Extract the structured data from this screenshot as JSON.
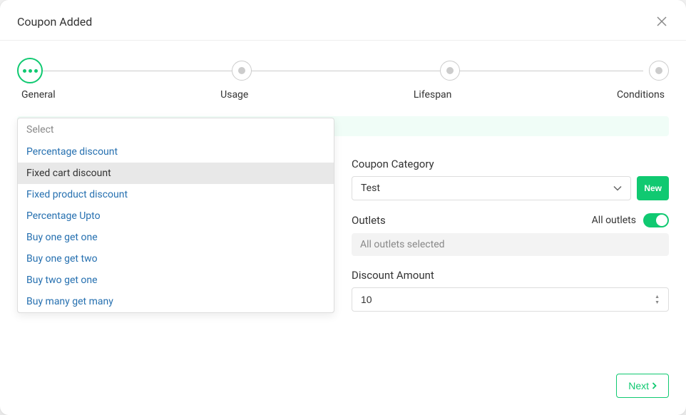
{
  "modal": {
    "title": "Coupon Added"
  },
  "stepper": {
    "steps": [
      {
        "label": "General",
        "active": true
      },
      {
        "label": "Usage",
        "active": false
      },
      {
        "label": "Lifespan",
        "active": false
      },
      {
        "label": "Conditions",
        "active": false
      }
    ]
  },
  "discount_type": {
    "select_label": "Select",
    "options": [
      "Percentage discount",
      "Fixed cart discount",
      "Fixed product discount",
      "Percentage Upto",
      "Buy one get one",
      "Buy one get two",
      "Buy two get one",
      "Buy many get many"
    ],
    "selected": "Fixed cart discount"
  },
  "coupon_category": {
    "label": "Coupon Category",
    "selected": "Test",
    "new_button": "New"
  },
  "outlets": {
    "label": "Outlets",
    "all_label": "All outlets",
    "all_enabled": true,
    "display_text": "All outlets selected"
  },
  "discount_amount": {
    "label": "Discount Amount",
    "value": "10"
  },
  "footer": {
    "next_label": "Next"
  }
}
